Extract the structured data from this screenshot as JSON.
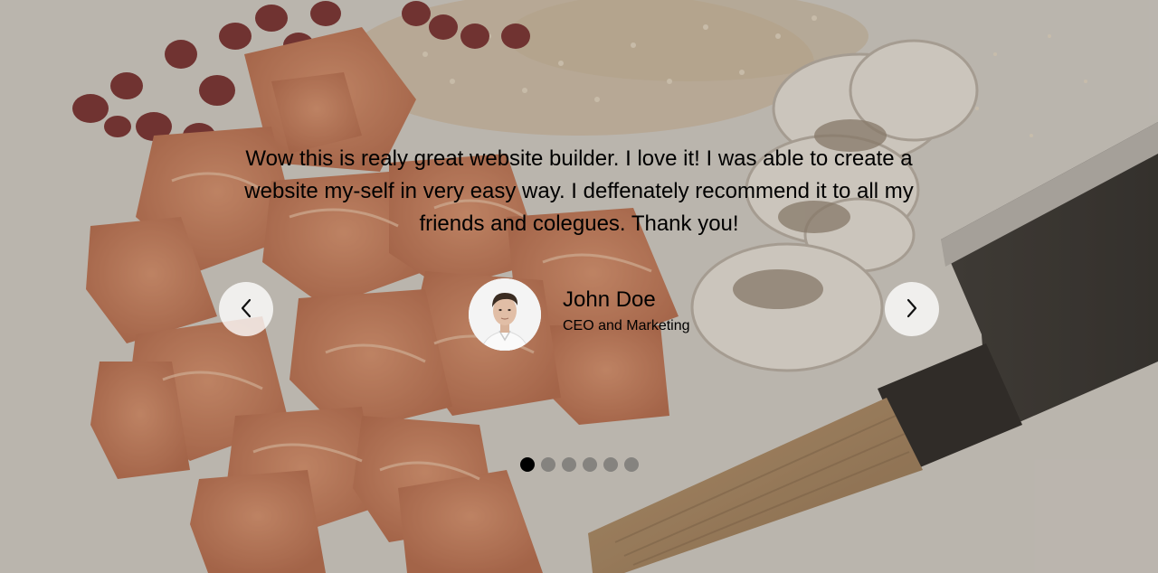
{
  "testimonial": {
    "quote": "Wow this is realy great website builder. I love it! I was able to create a website my-self in very easy way. I deffenately recommend it to all my friends and colegues. Thank you!",
    "author_name": "John Doe",
    "author_role": "CEO and Marketing"
  },
  "navigation": {
    "prev_icon": "chevron-left-icon",
    "next_icon": "chevron-right-icon"
  },
  "pagination": {
    "total": 6,
    "active_index": 0
  },
  "colors": {
    "text": "#000000",
    "dot_active": "#000000",
    "dot_inactive": "#6b6b6b",
    "nav_button_bg": "#ffffff"
  }
}
